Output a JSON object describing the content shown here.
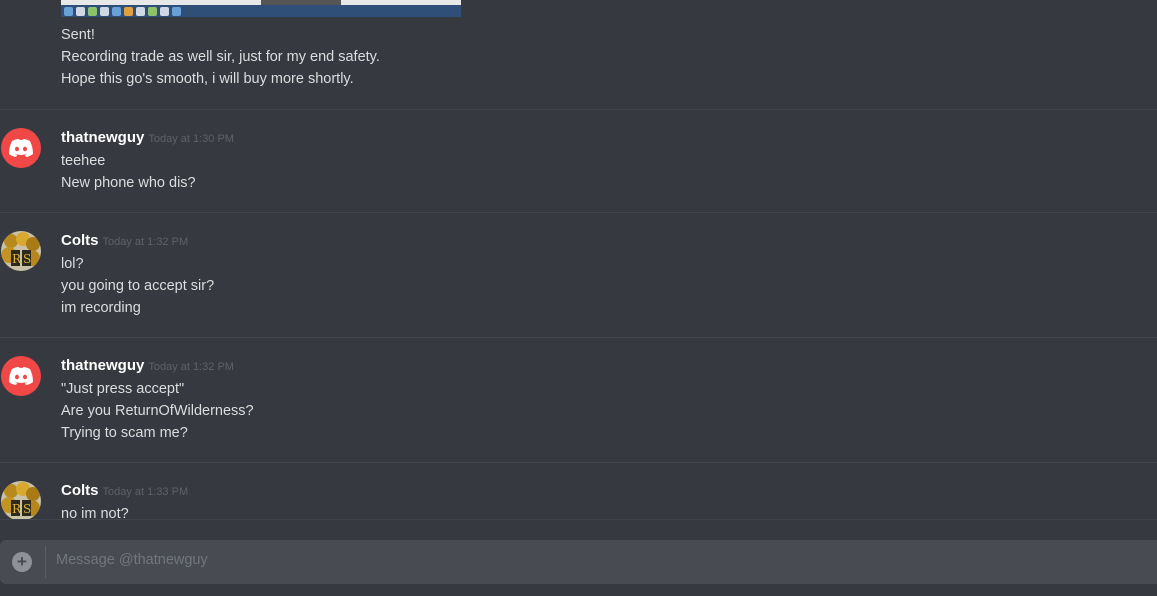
{
  "attachment": {
    "icon_colors": [
      "#cfd8e3",
      "#6aa0d8",
      "#8fc36a",
      "#e0a040"
    ]
  },
  "messages": [
    {
      "continued": true,
      "lines": [
        "Sent!",
        "Recording trade as well sir, just for my end safety.",
        "Hope this go's smooth, i will buy more shortly."
      ]
    },
    {
      "author": "thatnewguy",
      "timestamp": "Today at 1:30 PM",
      "avatar": "discord-logo-icon",
      "lines": [
        "teehee",
        "New phone who dis?"
      ]
    },
    {
      "author": "Colts",
      "timestamp": "Today at 1:32 PM",
      "avatar": "gold-coins-avatar",
      "lines": [
        "lol?",
        "you going to accept sir?",
        "im recording"
      ]
    },
    {
      "author": "thatnewguy",
      "timestamp": "Today at 1:32 PM",
      "avatar": "discord-logo-icon",
      "lines": [
        "\"Just press accept\"",
        "Are you ReturnOfWilderness?",
        "Trying to scam me?"
      ]
    },
    {
      "author": "Colts",
      "timestamp": "Today at 1:33 PM",
      "avatar": "gold-coins-avatar",
      "lines": [
        "no im not?"
      ]
    }
  ],
  "composer": {
    "placeholder": "Message @thatnewguy",
    "add_icon": "plus-circle-icon"
  },
  "colors": {
    "discord_red": "#f04747",
    "background": "#36393f",
    "composer_bg": "#484b51"
  }
}
